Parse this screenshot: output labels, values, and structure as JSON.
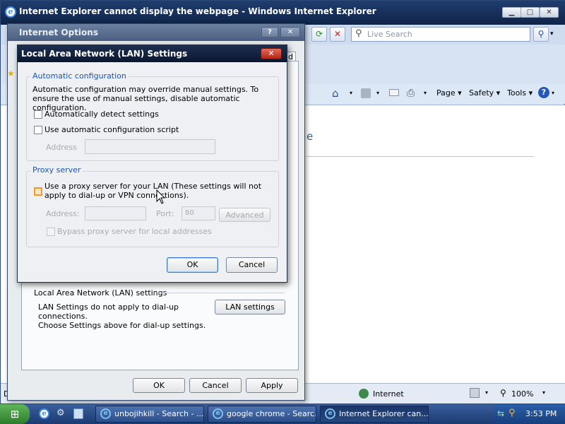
{
  "ie": {
    "title": "Internet Explorer cannot display the webpage - Windows Internet Explorer",
    "live_search_placeholder": "Live Search",
    "commands": {
      "page": "Page ▾",
      "safety": "Safety ▾",
      "tools": "Tools ▾"
    },
    "content_partial": "e",
    "status": {
      "zone": "Internet",
      "zoom": "100%",
      "left_partial": "Dor"
    }
  },
  "internet_options": {
    "title": "Internet Options",
    "tab_partial": "d",
    "lan_section_title": "Local Area Network (LAN) settings",
    "lan_section_text": "LAN Settings do not apply to dial-up connections.\nChoose Settings above for dial-up settings.",
    "lan_settings_button": "LAN settings",
    "ok": "OK",
    "cancel": "Cancel",
    "apply": "Apply"
  },
  "lan_dialog": {
    "title": "Local Area Network (LAN) Settings",
    "auto_config": {
      "heading": "Automatic configuration",
      "description": "Automatic configuration may override manual settings.  To ensure the use of manual settings, disable automatic configuration.",
      "auto_detect_label": "Automatically detect settings",
      "auto_detect_checked": false,
      "script_label": "Use automatic configuration script",
      "script_checked": false,
      "address_label": "Address",
      "address_value": ""
    },
    "proxy": {
      "heading": "Proxy server",
      "use_proxy_label": "Use a proxy server for your LAN (These settings will not apply to dial-up or VPN connections).",
      "use_proxy_checked": false,
      "address_label": "Address:",
      "address_value": "",
      "port_label": "Port:",
      "port_value": "80",
      "advanced_label": "Advanced",
      "bypass_label": "Bypass proxy server for local addresses",
      "bypass_checked": false
    },
    "ok": "OK",
    "cancel": "Cancel"
  },
  "taskbar": {
    "tasks": [
      {
        "label": "unbojihkill - Search - ..."
      },
      {
        "label": "google chrome - Searc..."
      },
      {
        "label": "Internet Explorer can..."
      }
    ],
    "clock": "3:53 PM"
  }
}
